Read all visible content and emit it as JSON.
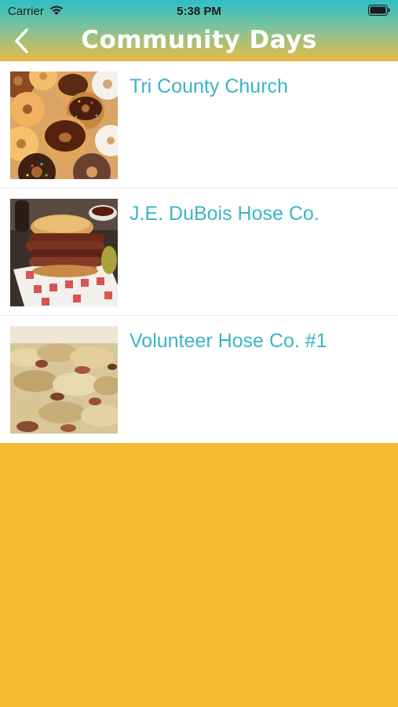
{
  "status_bar": {
    "carrier": "Carrier",
    "time": "5:38 PM",
    "wifi_icon": "wifi-icon",
    "battery_icon": "battery-icon"
  },
  "nav": {
    "title": "Community Days",
    "back_icon": "chevron-left-icon"
  },
  "colors": {
    "header_gradient": [
      "#2fbec6",
      "#e9ba45"
    ],
    "item_title": "#3ab4c8",
    "background": "#f8bb2f"
  },
  "items": [
    {
      "title": "Tri County Church",
      "image": "donuts-photo"
    },
    {
      "title": "J.E. DuBois Hose Co.",
      "image": "brisket-sandwich-photo"
    },
    {
      "title": "Volunteer Hose Co. #1",
      "image": "potatoes-photo"
    }
  ]
}
